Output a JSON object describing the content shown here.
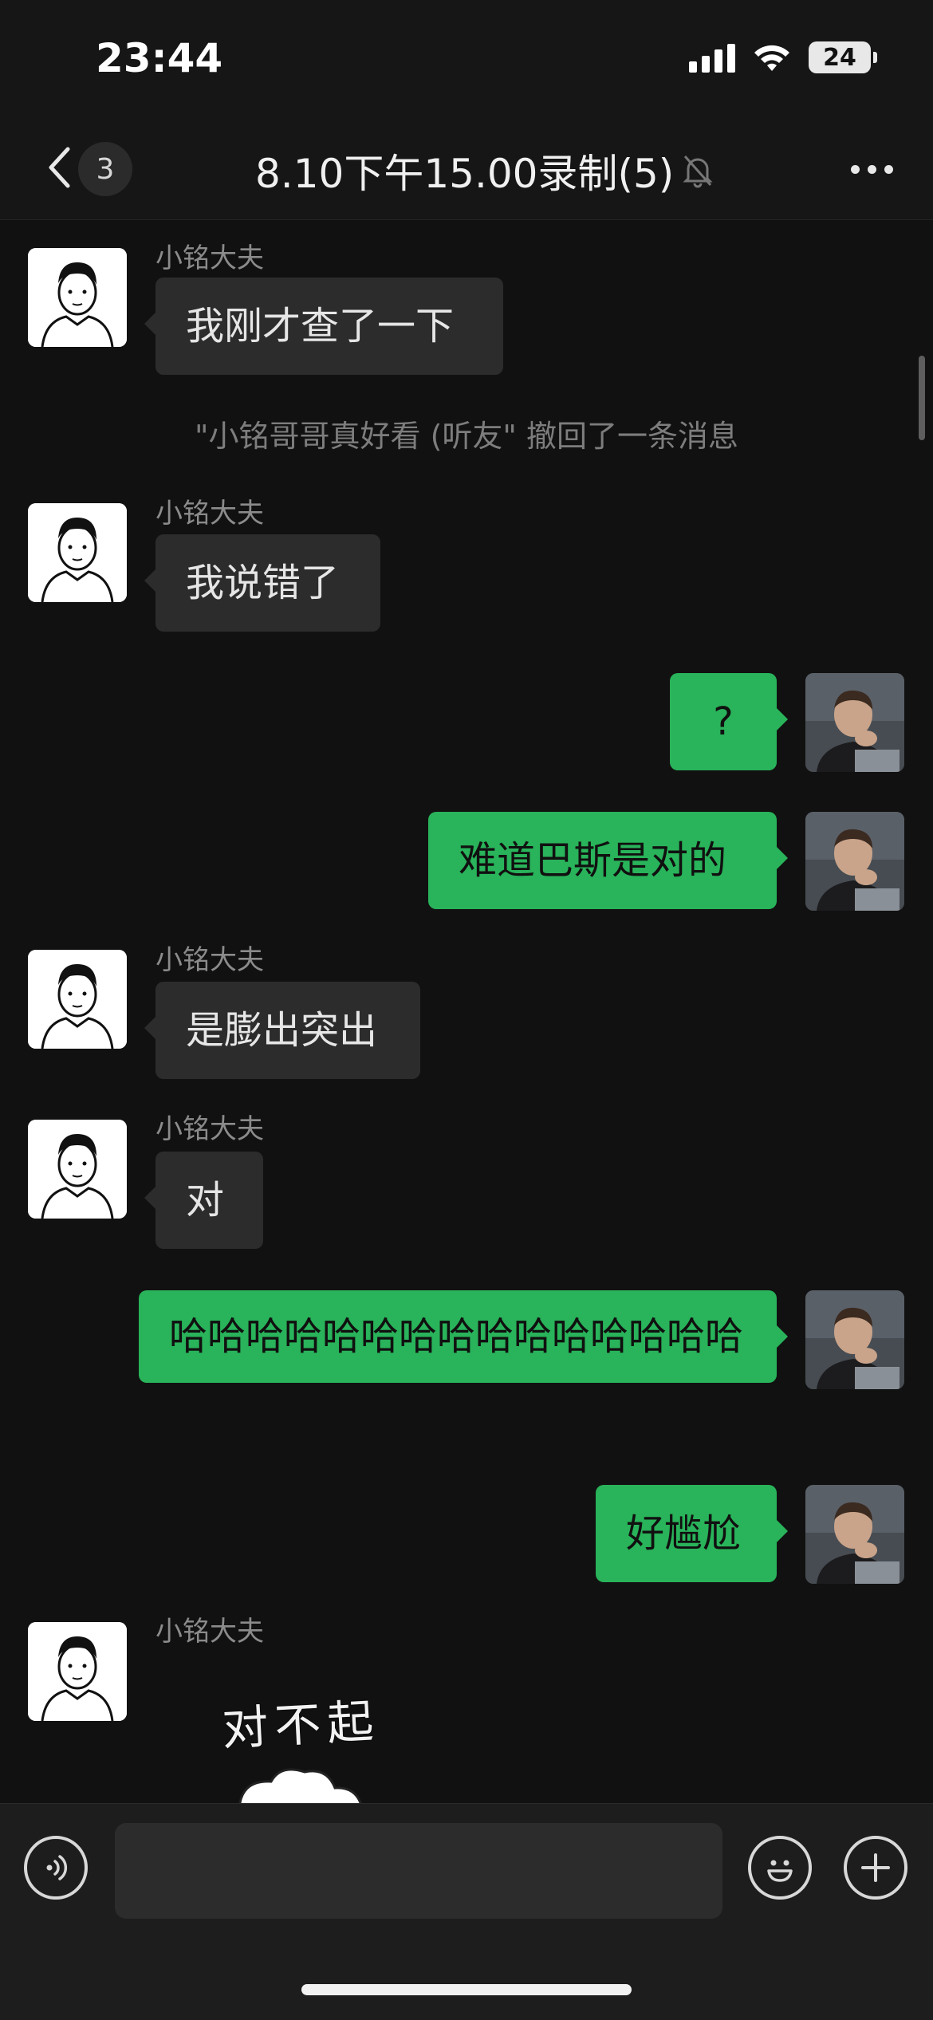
{
  "status_bar": {
    "time": "23:44",
    "battery": "24",
    "icons": [
      "signal-icon",
      "wifi-icon",
      "battery-icon"
    ]
  },
  "nav": {
    "back_icon": "chevron-left-icon",
    "unread_count": "3",
    "title": "8.10下午15.00录制(5)",
    "mute_icon": "bell-muted-icon",
    "more_icon": "more-horizontal-icon"
  },
  "colors": {
    "background": "#111111",
    "incoming_bubble": "#2c2c2c",
    "outgoing_bubble": "#29b35a",
    "secondary_text": "#8b8b8b"
  },
  "messages": [
    {
      "type": "incoming",
      "sender": "小铭大夫",
      "text": "我刚才查了一下"
    },
    {
      "type": "system",
      "text": "\"小铭哥哥真好看 (听友\" 撤回了一条消息"
    },
    {
      "type": "incoming",
      "sender": "小铭大夫",
      "text": "我说错了"
    },
    {
      "type": "outgoing",
      "text": "?"
    },
    {
      "type": "outgoing",
      "text": "难道巴斯是对的"
    },
    {
      "type": "incoming",
      "sender": "小铭大夫",
      "text": "是膨出突出"
    },
    {
      "type": "incoming",
      "sender": "小铭大夫",
      "text": "对"
    },
    {
      "type": "outgoing",
      "text": "哈哈哈哈哈哈哈哈哈哈哈哈哈哈哈"
    },
    {
      "type": "outgoing",
      "text": "好尴尬"
    },
    {
      "type": "incoming-sticker",
      "sender": "小铭大夫",
      "sticker_text": "对不起"
    }
  ],
  "input_bar": {
    "voice_icon": "voice-icon",
    "emoji_icon": "emoji-icon",
    "plus_icon": "plus-icon",
    "placeholder": ""
  }
}
